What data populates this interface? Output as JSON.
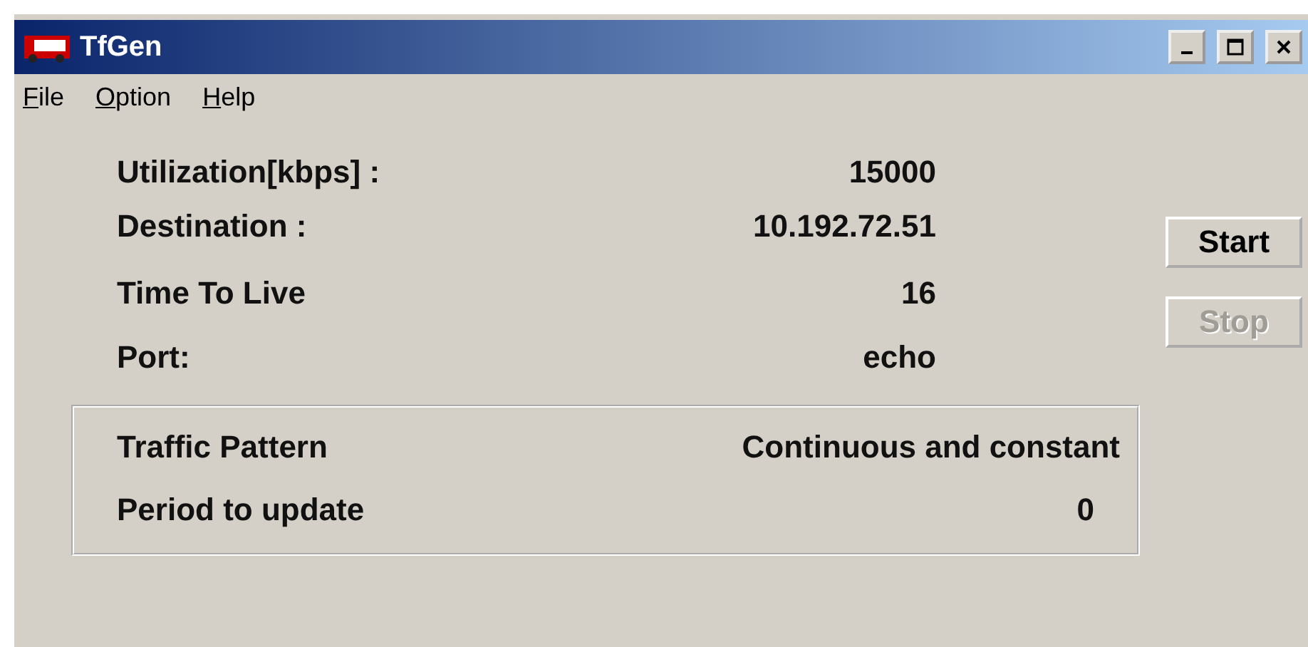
{
  "window": {
    "title": "TfGen"
  },
  "menu": [
    {
      "label": "File"
    },
    {
      "label": "Option"
    },
    {
      "label": "Help"
    }
  ],
  "settings": [
    {
      "label": "Utilization[kbps] :",
      "value": "15000"
    },
    {
      "label": "Destination :",
      "value": "10.192.72.51"
    },
    {
      "label": "Time To Live",
      "value": "16"
    },
    {
      "label": "Port:",
      "value": "echo"
    }
  ],
  "pattern_box": [
    {
      "label": "Traffic Pattern",
      "value": "Continuous and constant"
    },
    {
      "label": "Period to update",
      "value": "0"
    }
  ],
  "buttons": [
    {
      "label": "Start",
      "disabled": false
    },
    {
      "label": "Stop",
      "disabled": true
    }
  ]
}
